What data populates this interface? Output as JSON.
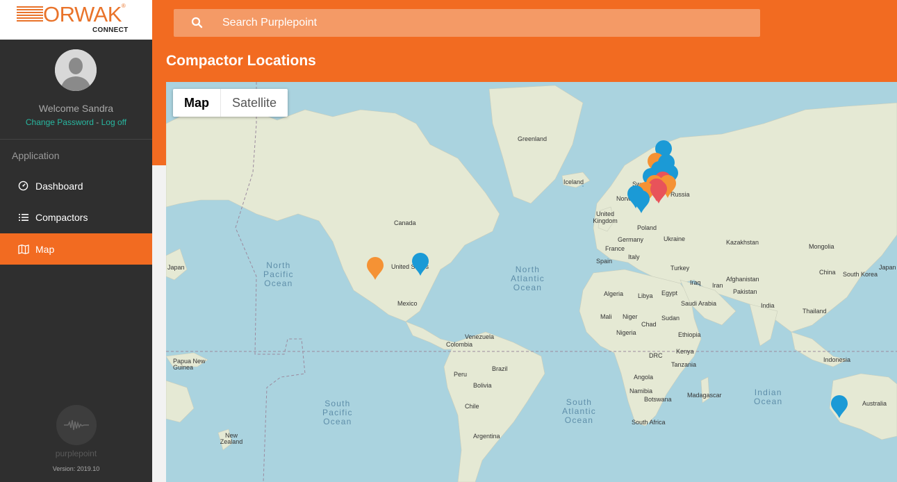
{
  "brand": {
    "logo_word": "ORWAK",
    "logo_reg": "®",
    "logo_sub": "CONNECT"
  },
  "user": {
    "welcome": "Welcome Sandra",
    "change_password": "Change Password",
    "separator": " - ",
    "logoff": "Log off"
  },
  "sidebar": {
    "section_title": "Application",
    "items": [
      {
        "label": "Dashboard",
        "icon": "gauge-icon"
      },
      {
        "label": "Compactors",
        "icon": "list-icon"
      },
      {
        "label": "Map",
        "icon": "map-icon",
        "active": true
      }
    ],
    "footer_name": "purplepoint",
    "version": "Version: 2019.10"
  },
  "search": {
    "placeholder": "Search Purplepoint"
  },
  "page": {
    "title": "Compactor Locations"
  },
  "map": {
    "type_options": [
      "Map",
      "Satellite"
    ],
    "selected_type": "Map",
    "countries": {
      "greenland": "Greenland",
      "iceland": "Iceland",
      "canada": "Canada",
      "us": "United States",
      "mexico": "Mexico",
      "venezuela": "Venezuela",
      "colombia": "Colombia",
      "peru": "Peru",
      "brazil": "Brazil",
      "bolivia": "Bolivia",
      "chile": "Chile",
      "argentina": "Argentina",
      "uk": "United Kingdom",
      "norway": "Norway",
      "sweden": "Sweden",
      "poland": "Poland",
      "germany": "Germany",
      "ukraine": "Ukraine",
      "france": "France",
      "spain": "Spain",
      "italy": "Italy",
      "turkey": "Turkey",
      "iraq": "Iraq",
      "iran": "Iran",
      "kazakhstan": "Kazakhstan",
      "mongolia": "Mongolia",
      "china": "China",
      "japan": "Japan",
      "south_korea": "South Korea",
      "afghanistan": "Afghanistan",
      "pakistan": "Pakistan",
      "india": "India",
      "thailand": "Thailand",
      "indonesia": "Indonesia",
      "australia": "Australia",
      "png": "Papua New Guinea",
      "nz": "New Zealand",
      "algeria": "Algeria",
      "libya": "Libya",
      "egypt": "Egypt",
      "saudi": "Saudi Arabia",
      "mali": "Mali",
      "niger": "Niger",
      "chad": "Chad",
      "sudan": "Sudan",
      "nigeria": "Nigeria",
      "ethiopia": "Ethiopia",
      "kenya": "Kenya",
      "drc": "DRC",
      "tanzania": "Tanzania",
      "angola": "Angola",
      "namibia": "Namibia",
      "botswana": "Botswana",
      "madagascar": "Madagascar",
      "south_africa": "South Africa",
      "russia": "Russia"
    },
    "oceans": {
      "north_pacific": [
        "North",
        "Pacific",
        "Ocean"
      ],
      "north_atlantic": [
        "North",
        "Atlantic",
        "Ocean"
      ],
      "south_pacific": [
        "South",
        "Pacific",
        "Ocean"
      ],
      "south_atlantic": [
        "South",
        "Atlantic",
        "Ocean"
      ],
      "indian": [
        "Indian",
        "Ocean"
      ]
    },
    "marker_colors": {
      "blue": "#1b9ad6",
      "orange": "#f59234",
      "red": "#e8535a"
    }
  }
}
